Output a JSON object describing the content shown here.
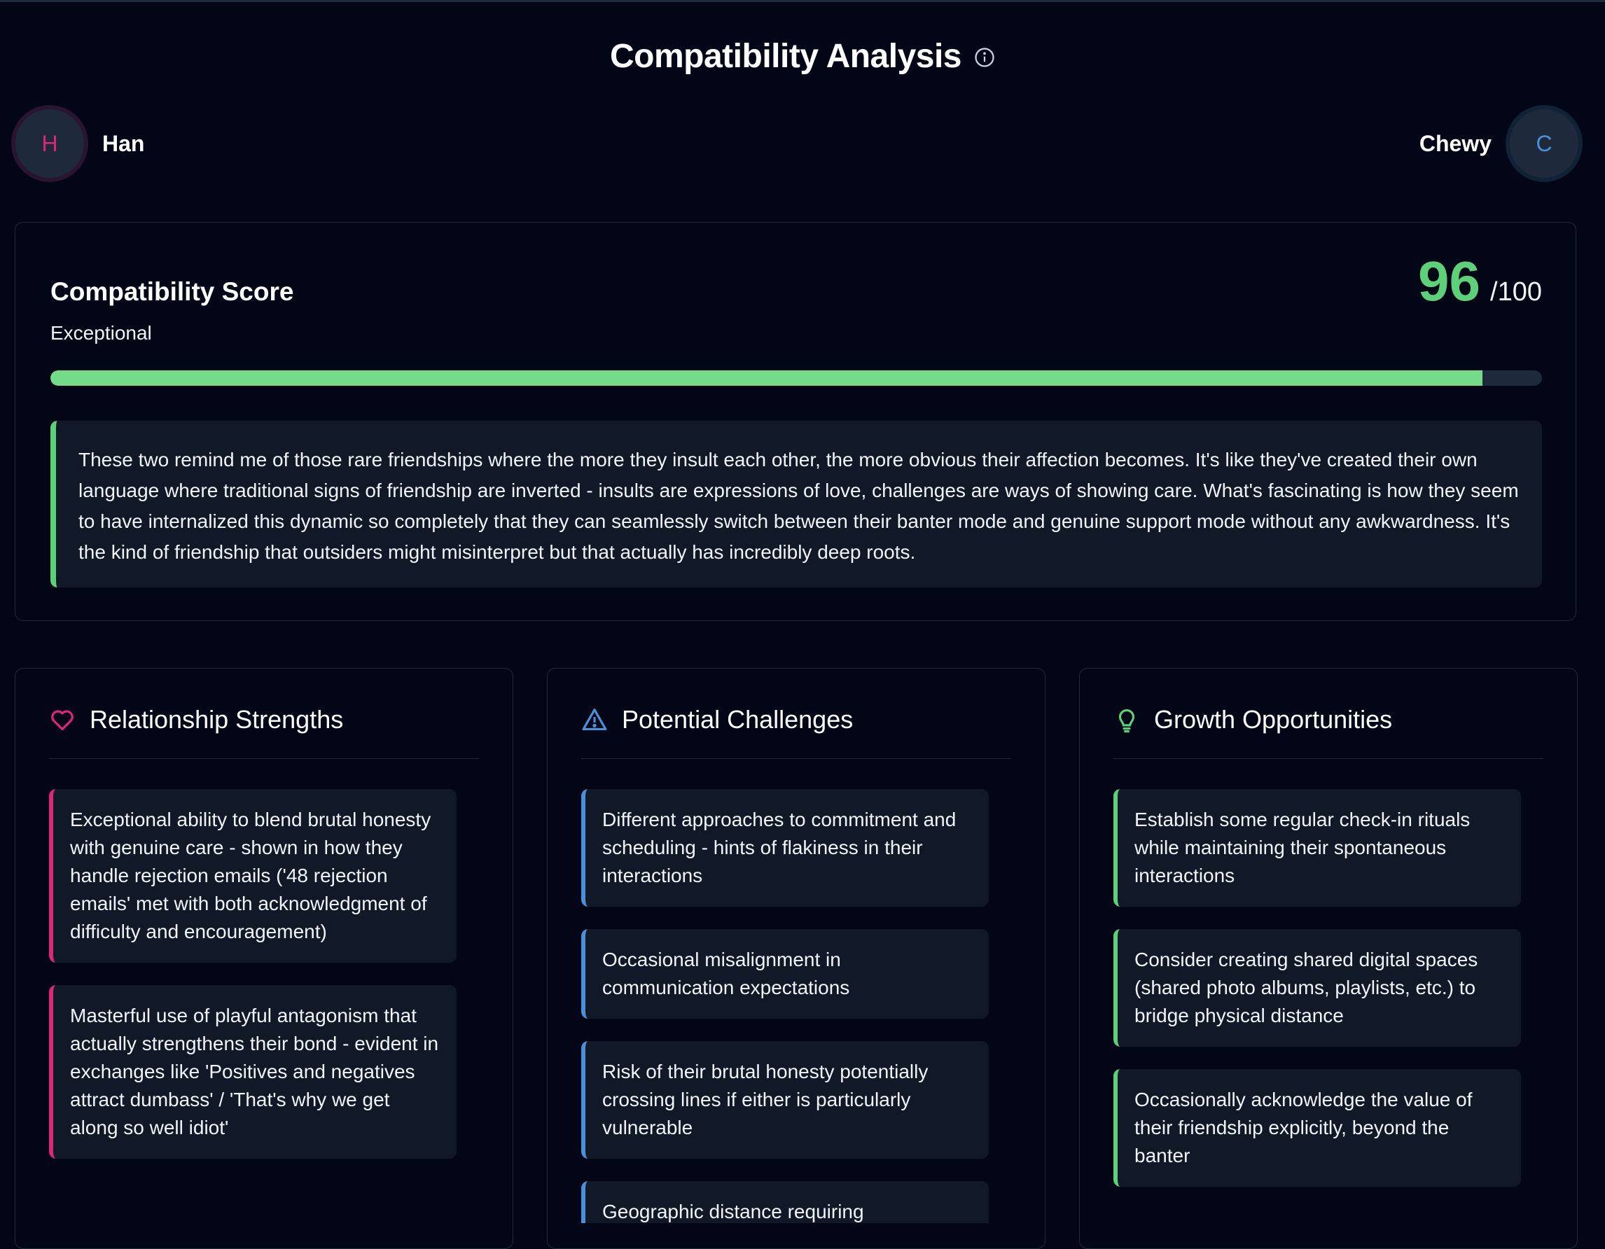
{
  "header": {
    "title": "Compatibility Analysis",
    "info_icon": "info-circle-icon"
  },
  "people": {
    "left": {
      "initial": "H",
      "name": "Han",
      "color": "#db2777"
    },
    "right": {
      "initial": "C",
      "name": "Chewy",
      "color": "#4a90d9"
    }
  },
  "score": {
    "title": "Compatibility Score",
    "rating": "Exceptional",
    "value": "96",
    "max": "/100",
    "progress_fraction": 0.96,
    "accent": "#5fd07a",
    "summary": "These two remind me of those rare friendships where the more they insult each other, the more obvious their affection becomes. It's like they've created their own language where traditional signs of friendship are inverted - insults are expressions of love, challenges are ways of showing care. What's fascinating is how they seem to have internalized this dynamic so completely that they can seamlessly switch between their banter mode and genuine support mode without any awkwardness. It's the kind of friendship that outsiders might misinterpret but that actually has incredibly deep roots."
  },
  "sections": [
    {
      "title": "Relationship Strengths",
      "icon": "heart-icon",
      "color": "#db2777",
      "items": [
        "Exceptional ability to blend brutal honesty with genuine care - shown in how they handle rejection emails ('48 rejection emails' met with both acknowledgment of difficulty and encouragement)",
        "Masterful use of playful antagonism that actually strengthens their bond - evident in exchanges like 'Positives and negatives attract dumbass' / 'That's why we get along so well idiot'"
      ]
    },
    {
      "title": "Potential Challenges",
      "icon": "warning-triangle-icon",
      "color": "#4a90d9",
      "items": [
        "Different approaches to commitment and scheduling - hints of flakiness in their interactions",
        "Occasional misalignment in communication expectations",
        "Risk of their brutal honesty potentially crossing lines if either is particularly vulnerable",
        "Geographic distance requiring"
      ]
    },
    {
      "title": "Growth Opportunities",
      "icon": "lightbulb-icon",
      "color": "#5fd07a",
      "items": [
        "Establish some regular check-in rituals while maintaining their spontaneous interactions",
        "Consider creating shared digital spaces (shared photo albums, playlists, etc.) to bridge physical distance",
        "Occasionally acknowledge the value of their friendship explicitly, beyond the banter"
      ]
    }
  ]
}
